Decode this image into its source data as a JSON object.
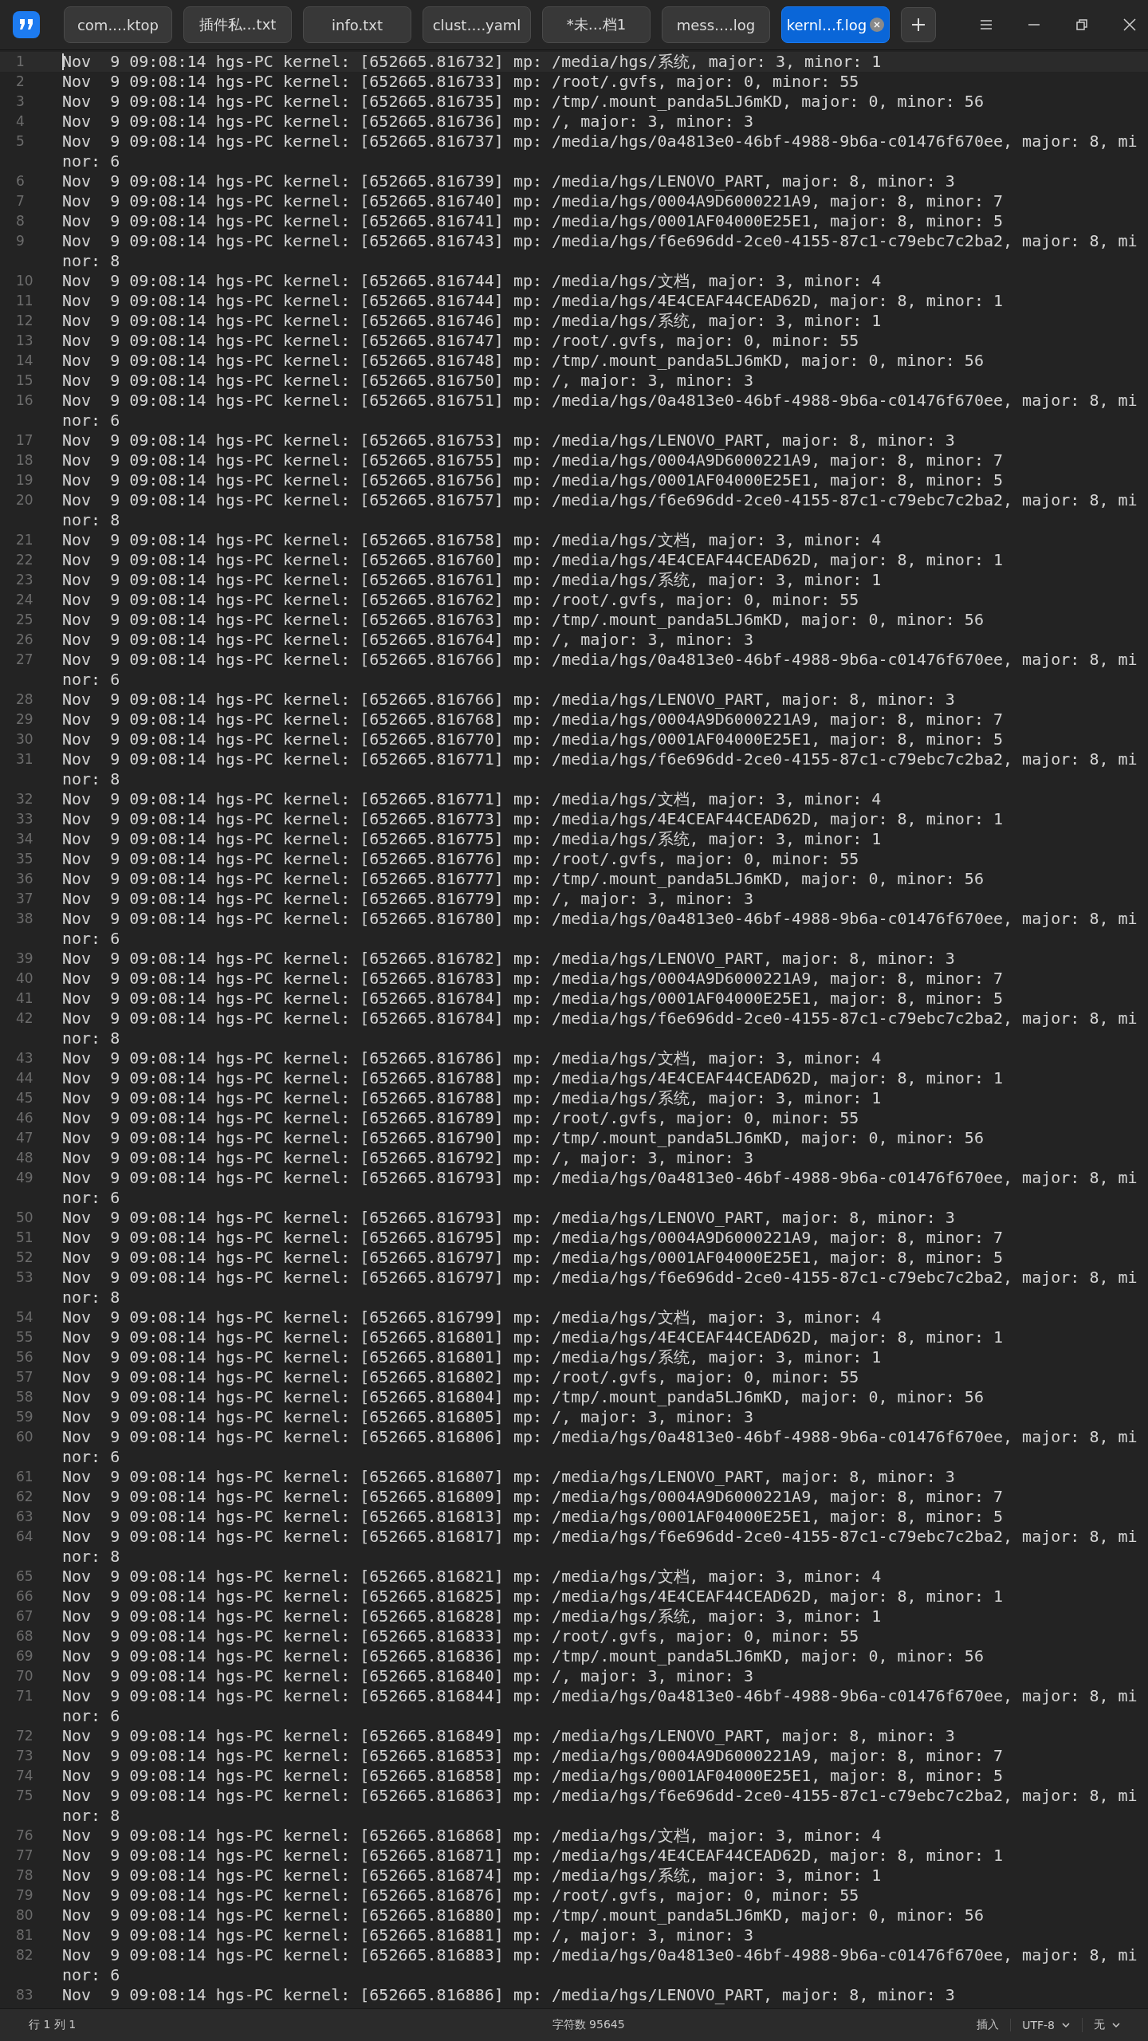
{
  "tabs": [
    {
      "label": "com.…ktop",
      "selected": false
    },
    {
      "label": "插件私…txt",
      "selected": false
    },
    {
      "label": "info.txt",
      "selected": false
    },
    {
      "label": "clust….yaml",
      "selected": false
    },
    {
      "label": "*未…档1",
      "selected": false
    },
    {
      "label": "mess….log",
      "selected": false
    },
    {
      "label": "kernl…f.log",
      "selected": true
    }
  ],
  "lines": [
    {
      "number": "1",
      "text": "Nov  9 09:08:14 hgs-PC kernel: [652665.816732] mp: /media/hgs/系统, major: 3, minor: 1",
      "current": true
    },
    {
      "number": "2",
      "text": "Nov  9 09:08:14 hgs-PC kernel: [652665.816733] mp: /root/.gvfs, major: 0, minor: 55",
      "current": false
    },
    {
      "number": "3",
      "text": "Nov  9 09:08:14 hgs-PC kernel: [652665.816735] mp: /tmp/.mount_panda5LJ6mKD, major: 0, minor: 56",
      "current": false
    },
    {
      "number": "4",
      "text": "Nov  9 09:08:14 hgs-PC kernel: [652665.816736] mp: /, major: 3, minor: 3",
      "current": false
    },
    {
      "number": "5",
      "text": "Nov  9 09:08:14 hgs-PC kernel: [652665.816737] mp: /media/hgs/0a4813e0-46bf-4988-9b6a-c01476f670ee, major: 8, minor: 6",
      "current": false
    },
    {
      "number": "6",
      "text": "Nov  9 09:08:14 hgs-PC kernel: [652665.816739] mp: /media/hgs/LENOVO_PART, major: 8, minor: 3",
      "current": false
    },
    {
      "number": "7",
      "text": "Nov  9 09:08:14 hgs-PC kernel: [652665.816740] mp: /media/hgs/0004A9D6000221A9, major: 8, minor: 7",
      "current": false
    },
    {
      "number": "8",
      "text": "Nov  9 09:08:14 hgs-PC kernel: [652665.816741] mp: /media/hgs/0001AF04000E25E1, major: 8, minor: 5",
      "current": false
    },
    {
      "number": "9",
      "text": "Nov  9 09:08:14 hgs-PC kernel: [652665.816743] mp: /media/hgs/f6e696dd-2ce0-4155-87c1-c79ebc7c2ba2, major: 8, minor: 8",
      "current": false
    },
    {
      "number": "10",
      "text": "Nov  9 09:08:14 hgs-PC kernel: [652665.816744] mp: /media/hgs/文档, major: 3, minor: 4",
      "current": false
    },
    {
      "number": "11",
      "text": "Nov  9 09:08:14 hgs-PC kernel: [652665.816744] mp: /media/hgs/4E4CEAF44CEAD62D, major: 8, minor: 1",
      "current": false
    },
    {
      "number": "12",
      "text": "Nov  9 09:08:14 hgs-PC kernel: [652665.816746] mp: /media/hgs/系统, major: 3, minor: 1",
      "current": false
    },
    {
      "number": "13",
      "text": "Nov  9 09:08:14 hgs-PC kernel: [652665.816747] mp: /root/.gvfs, major: 0, minor: 55",
      "current": false
    },
    {
      "number": "14",
      "text": "Nov  9 09:08:14 hgs-PC kernel: [652665.816748] mp: /tmp/.mount_panda5LJ6mKD, major: 0, minor: 56",
      "current": false
    },
    {
      "number": "15",
      "text": "Nov  9 09:08:14 hgs-PC kernel: [652665.816750] mp: /, major: 3, minor: 3",
      "current": false
    },
    {
      "number": "16",
      "text": "Nov  9 09:08:14 hgs-PC kernel: [652665.816751] mp: /media/hgs/0a4813e0-46bf-4988-9b6a-c01476f670ee, major: 8, minor: 6",
      "current": false
    },
    {
      "number": "17",
      "text": "Nov  9 09:08:14 hgs-PC kernel: [652665.816753] mp: /media/hgs/LENOVO_PART, major: 8, minor: 3",
      "current": false
    },
    {
      "number": "18",
      "text": "Nov  9 09:08:14 hgs-PC kernel: [652665.816755] mp: /media/hgs/0004A9D6000221A9, major: 8, minor: 7",
      "current": false
    },
    {
      "number": "19",
      "text": "Nov  9 09:08:14 hgs-PC kernel: [652665.816756] mp: /media/hgs/0001AF04000E25E1, major: 8, minor: 5",
      "current": false
    },
    {
      "number": "20",
      "text": "Nov  9 09:08:14 hgs-PC kernel: [652665.816757] mp: /media/hgs/f6e696dd-2ce0-4155-87c1-c79ebc7c2ba2, major: 8, minor: 8",
      "current": false
    },
    {
      "number": "21",
      "text": "Nov  9 09:08:14 hgs-PC kernel: [652665.816758] mp: /media/hgs/文档, major: 3, minor: 4",
      "current": false
    },
    {
      "number": "22",
      "text": "Nov  9 09:08:14 hgs-PC kernel: [652665.816760] mp: /media/hgs/4E4CEAF44CEAD62D, major: 8, minor: 1",
      "current": false
    },
    {
      "number": "23",
      "text": "Nov  9 09:08:14 hgs-PC kernel: [652665.816761] mp: /media/hgs/系统, major: 3, minor: 1",
      "current": false
    },
    {
      "number": "24",
      "text": "Nov  9 09:08:14 hgs-PC kernel: [652665.816762] mp: /root/.gvfs, major: 0, minor: 55",
      "current": false
    },
    {
      "number": "25",
      "text": "Nov  9 09:08:14 hgs-PC kernel: [652665.816763] mp: /tmp/.mount_panda5LJ6mKD, major: 0, minor: 56",
      "current": false
    },
    {
      "number": "26",
      "text": "Nov  9 09:08:14 hgs-PC kernel: [652665.816764] mp: /, major: 3, minor: 3",
      "current": false
    },
    {
      "number": "27",
      "text": "Nov  9 09:08:14 hgs-PC kernel: [652665.816766] mp: /media/hgs/0a4813e0-46bf-4988-9b6a-c01476f670ee, major: 8, minor: 6",
      "current": false
    },
    {
      "number": "28",
      "text": "Nov  9 09:08:14 hgs-PC kernel: [652665.816766] mp: /media/hgs/LENOVO_PART, major: 8, minor: 3",
      "current": false
    },
    {
      "number": "29",
      "text": "Nov  9 09:08:14 hgs-PC kernel: [652665.816768] mp: /media/hgs/0004A9D6000221A9, major: 8, minor: 7",
      "current": false
    },
    {
      "number": "30",
      "text": "Nov  9 09:08:14 hgs-PC kernel: [652665.816770] mp: /media/hgs/0001AF04000E25E1, major: 8, minor: 5",
      "current": false
    },
    {
      "number": "31",
      "text": "Nov  9 09:08:14 hgs-PC kernel: [652665.816771] mp: /media/hgs/f6e696dd-2ce0-4155-87c1-c79ebc7c2ba2, major: 8, minor: 8",
      "current": false
    },
    {
      "number": "32",
      "text": "Nov  9 09:08:14 hgs-PC kernel: [652665.816771] mp: /media/hgs/文档, major: 3, minor: 4",
      "current": false
    },
    {
      "number": "33",
      "text": "Nov  9 09:08:14 hgs-PC kernel: [652665.816773] mp: /media/hgs/4E4CEAF44CEAD62D, major: 8, minor: 1",
      "current": false
    },
    {
      "number": "34",
      "text": "Nov  9 09:08:14 hgs-PC kernel: [652665.816775] mp: /media/hgs/系统, major: 3, minor: 1",
      "current": false
    },
    {
      "number": "35",
      "text": "Nov  9 09:08:14 hgs-PC kernel: [652665.816776] mp: /root/.gvfs, major: 0, minor: 55",
      "current": false
    },
    {
      "number": "36",
      "text": "Nov  9 09:08:14 hgs-PC kernel: [652665.816777] mp: /tmp/.mount_panda5LJ6mKD, major: 0, minor: 56",
      "current": false
    },
    {
      "number": "37",
      "text": "Nov  9 09:08:14 hgs-PC kernel: [652665.816779] mp: /, major: 3, minor: 3",
      "current": false
    },
    {
      "number": "38",
      "text": "Nov  9 09:08:14 hgs-PC kernel: [652665.816780] mp: /media/hgs/0a4813e0-46bf-4988-9b6a-c01476f670ee, major: 8, minor: 6",
      "current": false
    },
    {
      "number": "39",
      "text": "Nov  9 09:08:14 hgs-PC kernel: [652665.816782] mp: /media/hgs/LENOVO_PART, major: 8, minor: 3",
      "current": false
    },
    {
      "number": "40",
      "text": "Nov  9 09:08:14 hgs-PC kernel: [652665.816783] mp: /media/hgs/0004A9D6000221A9, major: 8, minor: 7",
      "current": false
    },
    {
      "number": "41",
      "text": "Nov  9 09:08:14 hgs-PC kernel: [652665.816784] mp: /media/hgs/0001AF04000E25E1, major: 8, minor: 5",
      "current": false
    },
    {
      "number": "42",
      "text": "Nov  9 09:08:14 hgs-PC kernel: [652665.816784] mp: /media/hgs/f6e696dd-2ce0-4155-87c1-c79ebc7c2ba2, major: 8, minor: 8",
      "current": false
    },
    {
      "number": "43",
      "text": "Nov  9 09:08:14 hgs-PC kernel: [652665.816786] mp: /media/hgs/文档, major: 3, minor: 4",
      "current": false
    },
    {
      "number": "44",
      "text": "Nov  9 09:08:14 hgs-PC kernel: [652665.816788] mp: /media/hgs/4E4CEAF44CEAD62D, major: 8, minor: 1",
      "current": false
    },
    {
      "number": "45",
      "text": "Nov  9 09:08:14 hgs-PC kernel: [652665.816788] mp: /media/hgs/系统, major: 3, minor: 1",
      "current": false
    },
    {
      "number": "46",
      "text": "Nov  9 09:08:14 hgs-PC kernel: [652665.816789] mp: /root/.gvfs, major: 0, minor: 55",
      "current": false
    },
    {
      "number": "47",
      "text": "Nov  9 09:08:14 hgs-PC kernel: [652665.816790] mp: /tmp/.mount_panda5LJ6mKD, major: 0, minor: 56",
      "current": false
    },
    {
      "number": "48",
      "text": "Nov  9 09:08:14 hgs-PC kernel: [652665.816792] mp: /, major: 3, minor: 3",
      "current": false
    },
    {
      "number": "49",
      "text": "Nov  9 09:08:14 hgs-PC kernel: [652665.816793] mp: /media/hgs/0a4813e0-46bf-4988-9b6a-c01476f670ee, major: 8, minor: 6",
      "current": false
    },
    {
      "number": "50",
      "text": "Nov  9 09:08:14 hgs-PC kernel: [652665.816793] mp: /media/hgs/LENOVO_PART, major: 8, minor: 3",
      "current": false
    },
    {
      "number": "51",
      "text": "Nov  9 09:08:14 hgs-PC kernel: [652665.816795] mp: /media/hgs/0004A9D6000221A9, major: 8, minor: 7",
      "current": false
    },
    {
      "number": "52",
      "text": "Nov  9 09:08:14 hgs-PC kernel: [652665.816797] mp: /media/hgs/0001AF04000E25E1, major: 8, minor: 5",
      "current": false
    },
    {
      "number": "53",
      "text": "Nov  9 09:08:14 hgs-PC kernel: [652665.816797] mp: /media/hgs/f6e696dd-2ce0-4155-87c1-c79ebc7c2ba2, major: 8, minor: 8",
      "current": false
    },
    {
      "number": "54",
      "text": "Nov  9 09:08:14 hgs-PC kernel: [652665.816799] mp: /media/hgs/文档, major: 3, minor: 4",
      "current": false
    },
    {
      "number": "55",
      "text": "Nov  9 09:08:14 hgs-PC kernel: [652665.816801] mp: /media/hgs/4E4CEAF44CEAD62D, major: 8, minor: 1",
      "current": false
    },
    {
      "number": "56",
      "text": "Nov  9 09:08:14 hgs-PC kernel: [652665.816801] mp: /media/hgs/系统, major: 3, minor: 1",
      "current": false
    },
    {
      "number": "57",
      "text": "Nov  9 09:08:14 hgs-PC kernel: [652665.816802] mp: /root/.gvfs, major: 0, minor: 55",
      "current": false
    },
    {
      "number": "58",
      "text": "Nov  9 09:08:14 hgs-PC kernel: [652665.816804] mp: /tmp/.mount_panda5LJ6mKD, major: 0, minor: 56",
      "current": false
    },
    {
      "number": "59",
      "text": "Nov  9 09:08:14 hgs-PC kernel: [652665.816805] mp: /, major: 3, minor: 3",
      "current": false
    },
    {
      "number": "60",
      "text": "Nov  9 09:08:14 hgs-PC kernel: [652665.816806] mp: /media/hgs/0a4813e0-46bf-4988-9b6a-c01476f670ee, major: 8, minor: 6",
      "current": false
    },
    {
      "number": "61",
      "text": "Nov  9 09:08:14 hgs-PC kernel: [652665.816807] mp: /media/hgs/LENOVO_PART, major: 8, minor: 3",
      "current": false
    },
    {
      "number": "62",
      "text": "Nov  9 09:08:14 hgs-PC kernel: [652665.816809] mp: /media/hgs/0004A9D6000221A9, major: 8, minor: 7",
      "current": false
    },
    {
      "number": "63",
      "text": "Nov  9 09:08:14 hgs-PC kernel: [652665.816813] mp: /media/hgs/0001AF04000E25E1, major: 8, minor: 5",
      "current": false
    },
    {
      "number": "64",
      "text": "Nov  9 09:08:14 hgs-PC kernel: [652665.816817] mp: /media/hgs/f6e696dd-2ce0-4155-87c1-c79ebc7c2ba2, major: 8, minor: 8",
      "current": false
    },
    {
      "number": "65",
      "text": "Nov  9 09:08:14 hgs-PC kernel: [652665.816821] mp: /media/hgs/文档, major: 3, minor: 4",
      "current": false
    },
    {
      "number": "66",
      "text": "Nov  9 09:08:14 hgs-PC kernel: [652665.816825] mp: /media/hgs/4E4CEAF44CEAD62D, major: 8, minor: 1",
      "current": false
    },
    {
      "number": "67",
      "text": "Nov  9 09:08:14 hgs-PC kernel: [652665.816828] mp: /media/hgs/系统, major: 3, minor: 1",
      "current": false
    },
    {
      "number": "68",
      "text": "Nov  9 09:08:14 hgs-PC kernel: [652665.816833] mp: /root/.gvfs, major: 0, minor: 55",
      "current": false
    },
    {
      "number": "69",
      "text": "Nov  9 09:08:14 hgs-PC kernel: [652665.816836] mp: /tmp/.mount_panda5LJ6mKD, major: 0, minor: 56",
      "current": false
    },
    {
      "number": "70",
      "text": "Nov  9 09:08:14 hgs-PC kernel: [652665.816840] mp: /, major: 3, minor: 3",
      "current": false
    },
    {
      "number": "71",
      "text": "Nov  9 09:08:14 hgs-PC kernel: [652665.816844] mp: /media/hgs/0a4813e0-46bf-4988-9b6a-c01476f670ee, major: 8, minor: 6",
      "current": false
    },
    {
      "number": "72",
      "text": "Nov  9 09:08:14 hgs-PC kernel: [652665.816849] mp: /media/hgs/LENOVO_PART, major: 8, minor: 3",
      "current": false
    },
    {
      "number": "73",
      "text": "Nov  9 09:08:14 hgs-PC kernel: [652665.816853] mp: /media/hgs/0004A9D6000221A9, major: 8, minor: 7",
      "current": false
    },
    {
      "number": "74",
      "text": "Nov  9 09:08:14 hgs-PC kernel: [652665.816858] mp: /media/hgs/0001AF04000E25E1, major: 8, minor: 5",
      "current": false
    },
    {
      "number": "75",
      "text": "Nov  9 09:08:14 hgs-PC kernel: [652665.816863] mp: /media/hgs/f6e696dd-2ce0-4155-87c1-c79ebc7c2ba2, major: 8, minor: 8",
      "current": false
    },
    {
      "number": "76",
      "text": "Nov  9 09:08:14 hgs-PC kernel: [652665.816868] mp: /media/hgs/文档, major: 3, minor: 4",
      "current": false
    },
    {
      "number": "77",
      "text": "Nov  9 09:08:14 hgs-PC kernel: [652665.816871] mp: /media/hgs/4E4CEAF44CEAD62D, major: 8, minor: 1",
      "current": false
    },
    {
      "number": "78",
      "text": "Nov  9 09:08:14 hgs-PC kernel: [652665.816874] mp: /media/hgs/系统, major: 3, minor: 1",
      "current": false
    },
    {
      "number": "79",
      "text": "Nov  9 09:08:14 hgs-PC kernel: [652665.816876] mp: /root/.gvfs, major: 0, minor: 55",
      "current": false
    },
    {
      "number": "80",
      "text": "Nov  9 09:08:14 hgs-PC kernel: [652665.816880] mp: /tmp/.mount_panda5LJ6mKD, major: 0, minor: 56",
      "current": false
    },
    {
      "number": "81",
      "text": "Nov  9 09:08:14 hgs-PC kernel: [652665.816881] mp: /, major: 3, minor: 3",
      "current": false
    },
    {
      "number": "82",
      "text": "Nov  9 09:08:14 hgs-PC kernel: [652665.816883] mp: /media/hgs/0a4813e0-46bf-4988-9b6a-c01476f670ee, major: 8, minor: 6",
      "current": false
    },
    {
      "number": "83",
      "text": "Nov  9 09:08:14 hgs-PC kernel: [652665.816886] mp: /media/hgs/LENOVO_PART, major: 8, minor: 3",
      "current": false
    }
  ],
  "status_bar": {
    "position": "行 1 列 1",
    "char_count": "字符数 95645",
    "mode": "插入",
    "encoding": "UTF-8",
    "line_ending": "无"
  }
}
